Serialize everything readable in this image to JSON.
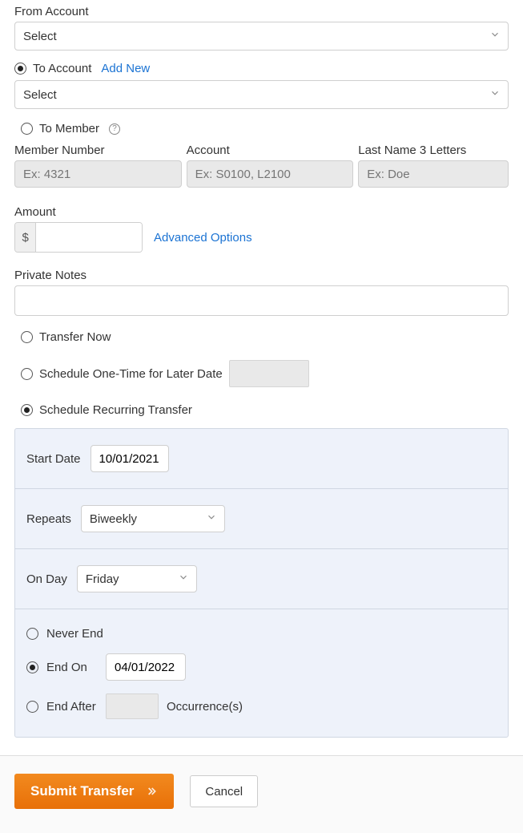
{
  "from": {
    "label": "From Account",
    "select_value": "Select"
  },
  "to": {
    "label": "To Account",
    "add_new": "Add New",
    "select_value": "Select"
  },
  "to_member": {
    "label": "To Member",
    "member_number_label": "Member Number",
    "account_label": "Account",
    "last_name_label": "Last Name 3 Letters",
    "member_number_placeholder": "Ex: 4321",
    "account_placeholder": "Ex: S0100, L2100",
    "last_name_placeholder": "Ex: Doe"
  },
  "amount": {
    "label": "Amount",
    "currency": "$",
    "advanced": "Advanced Options"
  },
  "notes": {
    "label": "Private Notes"
  },
  "timing": {
    "now": "Transfer Now",
    "one_time": "Schedule One-Time for Later Date",
    "recurring": "Schedule Recurring Transfer"
  },
  "recurring": {
    "start_label": "Start Date",
    "start_value": "10/01/2021",
    "repeats_label": "Repeats",
    "repeats_value": "Biweekly",
    "on_day_label": "On Day",
    "on_day_value": "Friday",
    "end": {
      "never": "Never End",
      "end_on": "End On",
      "end_on_value": "04/01/2022",
      "end_after": "End After",
      "occurrences": "Occurrence(s)"
    }
  },
  "footer": {
    "submit": "Submit Transfer",
    "cancel": "Cancel"
  }
}
